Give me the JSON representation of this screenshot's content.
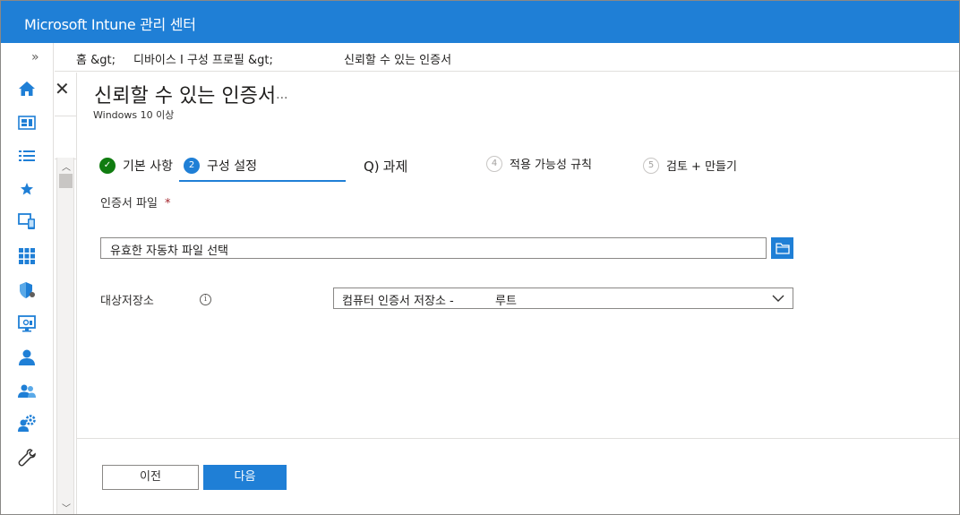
{
  "header": {
    "title": "Microsoft Intune 관리 센터"
  },
  "breadcrumb": {
    "home": "홈 &gt;",
    "devices": "디바이스 I 구성 프로필 &gt;",
    "current": "신뢰할 수 있는 인증서"
  },
  "rail": {
    "expand_glyph": "»",
    "items": [
      "home-icon",
      "dashboard-icon",
      "all-services-icon",
      "favorites-icon",
      "devices-icon",
      "apps-icon",
      "endpoint-security-icon",
      "reports-icon",
      "users-icon",
      "groups-icon",
      "tenant-admin-icon",
      "troubleshooting-icon"
    ]
  },
  "page": {
    "title": "신뢰할 수 있는 인증서",
    "more": "···",
    "subtitle": "Windows 10 이상",
    "close_glyph": "✕"
  },
  "steps": [
    {
      "number": "✓",
      "label": "기본 사항",
      "state": "done"
    },
    {
      "number": "2",
      "label": "구성 설정",
      "state": "active"
    },
    {
      "number": "Q)",
      "label": "과제",
      "state": "idle"
    },
    {
      "number": "4",
      "label": "적용 가능성 규칙",
      "state": "idle"
    },
    {
      "number": "5",
      "label": "검토 + 만들기",
      "state": "idle"
    }
  ],
  "form": {
    "cert_file_label": "인증서 파일",
    "required_mark": "*",
    "cert_file_placeholder": "유효한 자동차 파일 선택",
    "target_store_label": "대상저장소",
    "info_glyph": "i",
    "target_store_value_1": "컴퓨터 인증서 저장소 -",
    "target_store_value_2": "루트"
  },
  "footer": {
    "prev_label": "이전",
    "next_label": "다음"
  },
  "colors": {
    "brand": "#1f7fd6",
    "success": "#107c10",
    "required": "#a4262c"
  }
}
